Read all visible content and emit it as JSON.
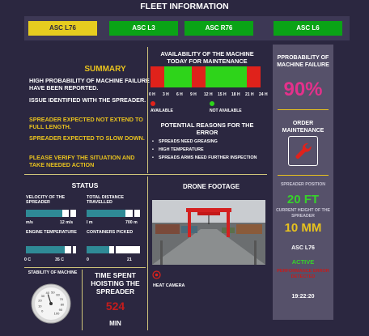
{
  "header": {
    "title": "FLEET INFORMATION"
  },
  "tabs": [
    {
      "label": "ASC L76",
      "color": "#e6cc1f",
      "selected": true
    },
    {
      "label": "ASC L3",
      "color": "#0aa316",
      "selected": false
    },
    {
      "label": "ASC R76",
      "color": "#0aa316",
      "selected": false
    },
    {
      "label": "ASC L6",
      "color": "#0aa316",
      "selected": false
    }
  ],
  "summary": {
    "title": "SUMMARY",
    "lines": [
      {
        "text": "HIGH PROBABILITY OF MACHINE FAILURE HAVE BEEN REPORTED.",
        "color": "white"
      },
      {
        "text": "ISSUE IDENTIFIED WITH THE SPREADER.",
        "color": "white"
      },
      {
        "text": "SPREADER EXPECTED NOT EXTEND TO FULL LENGTH.",
        "color": "yellow"
      },
      {
        "text": "SPREADER EXPECTED TO SLOW DOWN.",
        "color": "yellow"
      },
      {
        "text": "PLEASE VERIFY THE SITUATION AND TAKE NEEDED ACTION",
        "color": "yellow"
      }
    ]
  },
  "availability": {
    "title": "AVAILABILITY OF THE MACHINE TODAY FOR MAINTENANCE",
    "hour_labels": [
      "0 H",
      "3 H",
      "6 H",
      "9 H",
      "12 H",
      "15 H",
      "18 H",
      "21 H",
      "24 H"
    ],
    "segments": [
      {
        "from": 0,
        "to": 3,
        "status": "available"
      },
      {
        "from": 3,
        "to": 6,
        "status": "not_available"
      },
      {
        "from": 6,
        "to": 9,
        "status": "not_available"
      },
      {
        "from": 9,
        "to": 12,
        "status": "available"
      },
      {
        "from": 12,
        "to": 15,
        "status": "not_available"
      },
      {
        "from": 15,
        "to": 18,
        "status": "not_available"
      },
      {
        "from": 18,
        "to": 21,
        "status": "not_available"
      },
      {
        "from": 21,
        "to": 24,
        "status": "available"
      }
    ],
    "legend": {
      "available": "AVAILABLE",
      "not_available": "NOT AVAILABLE"
    },
    "colors": {
      "available": "#e0221b",
      "not_available": "#2ed41a"
    }
  },
  "reasons": {
    "title": "POTENTIAL REASONS FOR THE ERROR",
    "items": [
      "SPREADS NEED GREASING",
      "HIGH TEMPERATURE",
      "SPREADS ARMS NEED FURTHER INSPECTION"
    ]
  },
  "right_panel": {
    "probability_title": "PPROBABILITY OF MACHINE FAILURE",
    "probability_value": "90%",
    "order_title": "ORDER MAINTENANCE",
    "order_icon": "wrench-icon",
    "spreader_position_label": "SPREADER POSITION",
    "spreader_position_value": "20 FT",
    "height_label": "CURRENT HEIGHT OF THE SPREADER",
    "height_value": "10 MM",
    "machine": "ASC L76",
    "state": "ACTIVE",
    "alert": "PERFORMANCE ERROR DETECTED",
    "time": "19:22:20"
  },
  "status": {
    "title": "STATUS",
    "gauges": [
      {
        "label": "VELOCITY OF THE SPREADER",
        "min": "m/s",
        "max": "12 m/s",
        "fill": 0.72,
        "marker": 0.86
      },
      {
        "label": "TOTAL DISTANCE TRAVELLED",
        "min": "l m",
        "max": "700 m",
        "fill": 0.72,
        "marker": 0.86
      },
      {
        "label": "ENGINE TEMPERATURE",
        "min": "0 C",
        "max": "35 C",
        "fill": 0.78,
        "marker": 0.9
      },
      {
        "label": "CONTAINERS PICKED",
        "min": "0",
        "max": "21",
        "fill": 0.42,
        "marker": 0.52
      }
    ],
    "stability_label": "STABILITY OF MACHINE",
    "stability_ticks": [
      "0",
      "10",
      "20",
      "30",
      "40",
      "50",
      "60",
      "70",
      "80",
      "90",
      "100"
    ],
    "stability_value": 40,
    "time_title": "TIME SPENT HOISTING THE SPREADER",
    "time_value": "524",
    "time_unit": "MIN"
  },
  "drone": {
    "title": "DRONE FOOTAGE",
    "heat_label": "HEAT CAMERA",
    "heat_icon": "target-icon"
  }
}
